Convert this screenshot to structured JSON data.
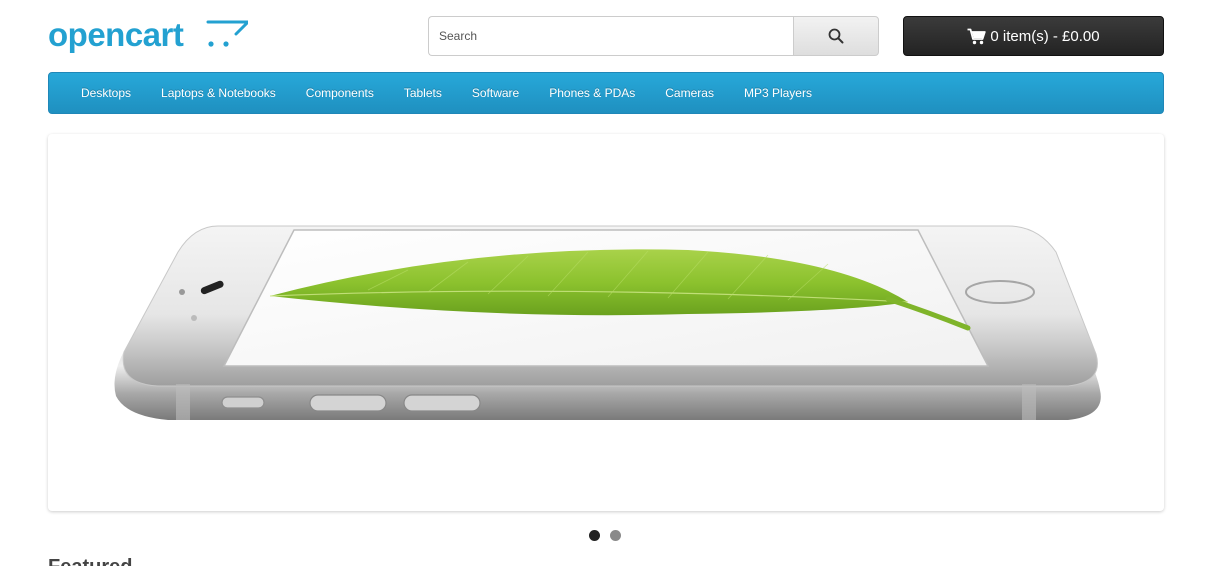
{
  "header": {
    "logo_text": "opencart",
    "search": {
      "placeholder": "Search",
      "value": ""
    },
    "search_button_icon": "search-icon",
    "cart": {
      "icon": "shopping-cart-icon",
      "label": "0 item(s) - £0.00"
    }
  },
  "menu": {
    "items": [
      {
        "label": "Desktops"
      },
      {
        "label": "Laptops & Notebooks"
      },
      {
        "label": "Components"
      },
      {
        "label": "Tablets"
      },
      {
        "label": "Software"
      },
      {
        "label": "Phones & PDAs"
      },
      {
        "label": "Cameras"
      },
      {
        "label": "MP3 Players"
      }
    ]
  },
  "slideshow": {
    "slide_image": "iphone-6-leaf-banner",
    "active_slide": 1,
    "total_slides": 2
  },
  "content": {
    "heading": "Featured"
  },
  "colors": {
    "brand_blue": "#23a1d1",
    "menu_blue": "#229ac8",
    "cart_dark": "#303030",
    "active_dot": "#222222",
    "inactive_dot": "#8a8a8a"
  }
}
